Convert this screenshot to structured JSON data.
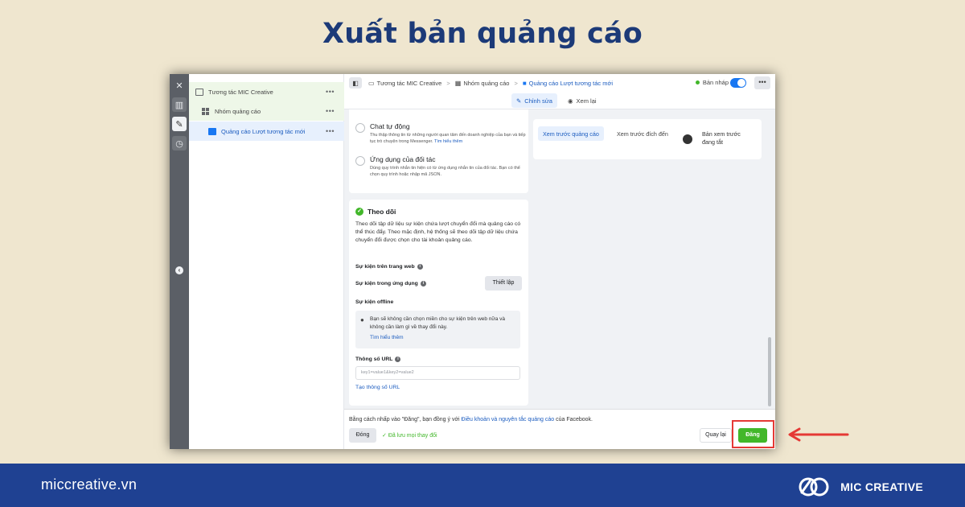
{
  "headline": "Xuất bản quảng cáo",
  "tree": {
    "campaign": "Tương tác MIC Creative",
    "adset": "Nhóm quảng cáo",
    "ad": "Quảng cáo Lượt tương tác mới",
    "more": "•••"
  },
  "topbar": {
    "crumbs": [
      "Tương tác MIC Creative",
      "Nhóm quảng cáo",
      "Quảng cáo Lượt tương tác mới"
    ],
    "separator": ">",
    "status": "Bản nháp",
    "more": "•••"
  },
  "tabs": {
    "edit": "Chỉnh sửa",
    "review": "Xem lại"
  },
  "options": [
    {
      "title": "Chat tự động",
      "desc": "Thu thập thông tin từ những người quan tâm đến doanh nghiệp của bạn và tiếp tục trò chuyện trong Messenger.",
      "link": "Tìm hiểu thêm"
    },
    {
      "title": "Ứng dụng của đối tác",
      "desc": "Dùng quy trình nhắn tin hiện có từ ứng dụng nhắn tin của đối tác. Bạn có thể chọn quy trình hoặc nhập mã JSON."
    }
  ],
  "tracking": {
    "title": "Theo dõi",
    "desc": "Theo dõi tập dữ liệu sự kiện chứa lượt chuyển đổi mà quảng cáo có thể thúc đẩy. Theo mặc định, hệ thống sẽ theo dõi tập dữ liệu chứa chuyển đổi được chọn cho tài khoản quảng cáo.",
    "web_events": "Sự kiện trên trang web",
    "app_events": "Sự kiện trong ứng dụng",
    "setup": "Thiết lập",
    "offline_events": "Sự kiện offline",
    "tip": "Bạn sẽ không cần chọn miền cho sự kiện trên web nữa và không cần làm gì về thay đổi này.",
    "tip_link": "Tìm hiểu thêm",
    "url_label": "Thông số URL",
    "url_placeholder": "key1=value1&key2=value2",
    "url_link": "Tạo thông số URL"
  },
  "preview": {
    "tab_ad": "Xem trước quảng cáo",
    "tab_dest": "Xem trước đích đến",
    "status": "Bản xem trước đang tắt"
  },
  "footer": {
    "terms_pre": "Bằng cách nhấp vào \"Đăng\", bạn đồng ý với ",
    "terms_link": "Điều khoản và nguyên tắc quảng cáo",
    "terms_post": " của Facebook.",
    "close": "Đóng",
    "saved": "Đã lưu mọi thay đổi",
    "back": "Quay lại",
    "publish": "Đăng"
  },
  "site": "miccreative.vn",
  "brand": "MIC CREATIVE",
  "colors": {
    "accent": "#1877f2",
    "publish": "#42b72a",
    "highlight": "#e53935",
    "banner": "#1f4192",
    "background": "#efe6cf"
  }
}
